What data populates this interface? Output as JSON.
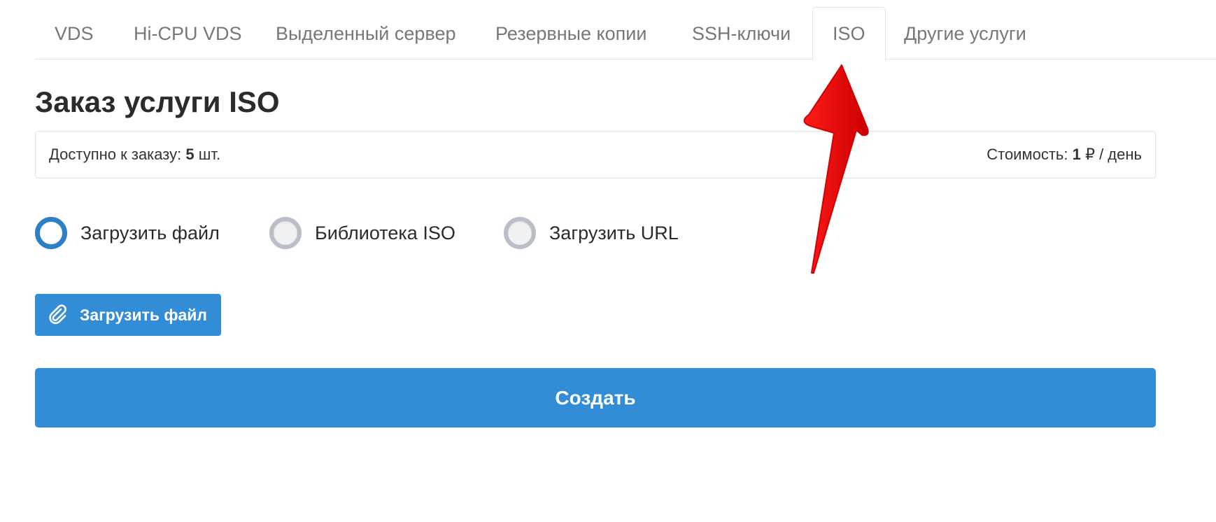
{
  "tabs": [
    {
      "label": "VDS"
    },
    {
      "label": "Hi-CPU VDS"
    },
    {
      "label": "Выделенный сервер"
    },
    {
      "label": "Резервные копии"
    },
    {
      "label": "SSH-ключи"
    },
    {
      "label": "ISO",
      "active": true
    },
    {
      "label": "Другие услуги"
    }
  ],
  "page": {
    "title": "Заказ услуги ISO"
  },
  "info": {
    "available_label": "Доступно к заказу: ",
    "available_count": "5",
    "available_unit": " шт.",
    "cost_label": "Стоимость: ",
    "cost_value": "1",
    "cost_unit": " ₽ / день"
  },
  "source_options": [
    {
      "label": "Загрузить файл",
      "selected": true
    },
    {
      "label": "Библиотека ISO",
      "selected": false
    },
    {
      "label": "Загрузить URL",
      "selected": false
    }
  ],
  "upload": {
    "label": "Загрузить файл",
    "icon": "paperclip-icon"
  },
  "submit": {
    "label": "Создать"
  },
  "colors": {
    "accent": "#338cd6",
    "annotation_arrow": "#e8000b"
  }
}
